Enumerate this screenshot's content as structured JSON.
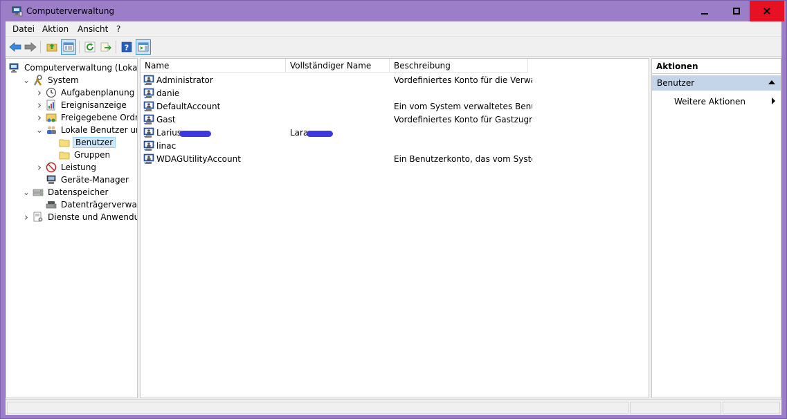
{
  "window": {
    "title": "Computerverwaltung",
    "colors": {
      "titlebar": "#9c7ec8",
      "close": "#e81123"
    }
  },
  "menu": [
    "Datei",
    "Aktion",
    "Ansicht",
    "?"
  ],
  "toolbar": [
    "back-icon",
    "forward-icon",
    "up-folder-icon",
    "show-tree-icon",
    "refresh-icon",
    "export-icon",
    "help-icon",
    "show-action-pane-icon"
  ],
  "tree": [
    {
      "label": "Computerverwaltung (Lokal)",
      "icon": "computer-management-icon",
      "level": 0,
      "arrow": ""
    },
    {
      "label": "System",
      "icon": "system-tools-icon",
      "level": 1,
      "arrow": "expanded"
    },
    {
      "label": "Aufgabenplanung",
      "icon": "clock-icon",
      "level": 2,
      "arrow": "collapsed"
    },
    {
      "label": "Ereignisanzeige",
      "icon": "event-viewer-icon",
      "level": 2,
      "arrow": "collapsed"
    },
    {
      "label": "Freigegebene Ordner",
      "icon": "shared-folder-icon",
      "level": 2,
      "arrow": "collapsed"
    },
    {
      "label": "Lokale Benutzer und Gru",
      "icon": "users-icon",
      "level": 2,
      "arrow": "expanded"
    },
    {
      "label": "Benutzer",
      "icon": "folder-icon",
      "level": 3,
      "arrow": "",
      "selected": true
    },
    {
      "label": "Gruppen",
      "icon": "folder-icon",
      "level": 3,
      "arrow": ""
    },
    {
      "label": "Leistung",
      "icon": "performance-icon",
      "level": 2,
      "arrow": "collapsed"
    },
    {
      "label": "Geräte-Manager",
      "icon": "device-manager-icon",
      "level": 2,
      "arrow": ""
    },
    {
      "label": "Datenspeicher",
      "icon": "storage-icon",
      "level": 1,
      "arrow": "expanded"
    },
    {
      "label": "Datenträgerverwaltung",
      "icon": "disk-management-icon",
      "level": 2,
      "arrow": ""
    },
    {
      "label": "Dienste und Anwendungen",
      "icon": "services-icon",
      "level": 1,
      "arrow": "collapsed"
    }
  ],
  "scrollbar": {
    "thumb_glyph": "III"
  },
  "columns": [
    "Name",
    "Vollständiger Name",
    "Beschreibung"
  ],
  "users": [
    {
      "name": "Administrator",
      "fullname": "",
      "description": "Vordefiniertes Konto für die Verwa...",
      "redact_name": false,
      "redact_full": false
    },
    {
      "name": "danie",
      "fullname": "",
      "description": "",
      "redact_name": false,
      "redact_full": false
    },
    {
      "name": "DefaultAccount",
      "fullname": "",
      "description": "Ein vom System verwaltetes Benu...",
      "redact_name": false,
      "redact_full": false
    },
    {
      "name": "Gast",
      "fullname": "",
      "description": "Vordefiniertes Konto für Gastzugri...",
      "redact_name": false,
      "redact_full": false
    },
    {
      "name": "Larius",
      "fullname": "Lara",
      "description": "",
      "redact_name": true,
      "redact_full": true
    },
    {
      "name": "linac",
      "fullname": "",
      "description": "",
      "redact_name": false,
      "redact_full": false
    },
    {
      "name": "WDAGUtilityAccount",
      "fullname": "",
      "description": "Ein Benutzerkonto, das vom Syste...",
      "redact_name": false,
      "redact_full": false
    }
  ],
  "actions": {
    "title": "Aktionen",
    "group": "Benutzer",
    "more": "Weitere Aktionen"
  }
}
